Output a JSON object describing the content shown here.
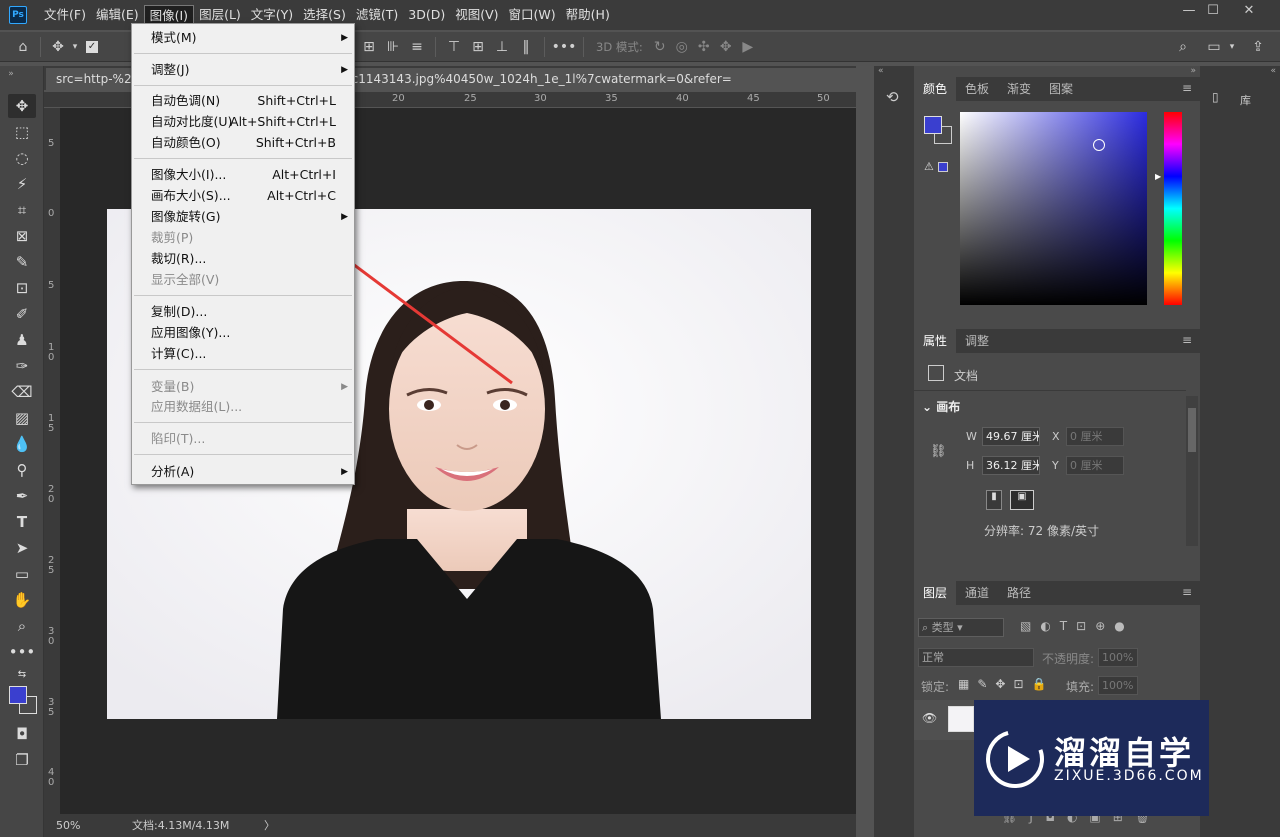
{
  "app": {
    "logo": "Ps"
  },
  "menubar": {
    "items": [
      "文件(F)",
      "编辑(E)",
      "图像(I)",
      "图层(L)",
      "文字(Y)",
      "选择(S)",
      "滤镜(T)",
      "3D(D)",
      "视图(V)",
      "窗口(W)",
      "帮助(H)"
    ],
    "active_index": 2
  },
  "window_controls": {
    "minimize": "—",
    "maximize": "☐",
    "close": "✕"
  },
  "options_bar": {
    "mode_label": "3D 模式:",
    "more": "•••"
  },
  "document_tab": {
    "title": "src=http-%2F%2F...6938a0b879cfe1e68e599192c1143143.jpg%40450w_1024h_1e_1l%7cwatermark=0&refer="
  },
  "ruler": {
    "h_ticks": [
      "20",
      "25",
      "30",
      "35",
      "40",
      "45",
      "50"
    ],
    "v_ticks": [
      "5",
      "0",
      "5",
      "1\n0",
      "1\n5",
      "2\n0",
      "2\n5",
      "3\n0",
      "3\n5",
      "4\n0"
    ]
  },
  "status": {
    "zoom": "50%",
    "doc": "文档:4.13M/4.13M",
    "arrow": "〉"
  },
  "image_menu": {
    "mode": "模式(M)",
    "adjust": "调整(J)",
    "auto_tone": "自动色调(N)",
    "auto_tone_sc": "Shift+Ctrl+L",
    "auto_contrast": "自动对比度(U)",
    "auto_contrast_sc": "Alt+Shift+Ctrl+L",
    "auto_color": "自动颜色(O)",
    "auto_color_sc": "Shift+Ctrl+B",
    "image_size": "图像大小(I)...",
    "image_size_sc": "Alt+Ctrl+I",
    "canvas_size": "画布大小(S)...",
    "canvas_size_sc": "Alt+Ctrl+C",
    "rotation": "图像旋转(G)",
    "crop": "裁剪(P)",
    "trim": "裁切(R)...",
    "reveal_all": "显示全部(V)",
    "duplicate": "复制(D)...",
    "apply_image": "应用图像(Y)...",
    "calculations": "计算(C)...",
    "variables": "变量(B)",
    "apply_data_set": "应用数据组(L)...",
    "trap": "陷印(T)...",
    "analysis": "分析(A)"
  },
  "color_panel": {
    "tabs": [
      "颜色",
      "色板",
      "渐变",
      "图案"
    ],
    "fg": "#3a3fcf",
    "bg": "#4a4a4a"
  },
  "properties_panel": {
    "tabs": [
      "属性",
      "调整"
    ],
    "doc_label": "文档",
    "section": "画布",
    "w_label": "W",
    "w_value": "49.67 厘米",
    "h_label": "H",
    "h_value": "36.12 厘米",
    "x_label": "X",
    "x_value": "0 厘米",
    "y_label": "Y",
    "y_value": "0 厘米",
    "resolution": "分辨率: 72 像素/英寸"
  },
  "layers_panel": {
    "tabs": [
      "图层",
      "通道",
      "路径"
    ],
    "filter": "类型",
    "blend": "正常",
    "opacity_label": "不透明度:",
    "opacity": "100%",
    "lock_label": "锁定:",
    "fill_label": "填充:",
    "fill": "100%"
  },
  "library": {
    "label": "库"
  },
  "watermark": {
    "title": "溜溜自学",
    "url": "ZIXUE.3D66.COM"
  }
}
